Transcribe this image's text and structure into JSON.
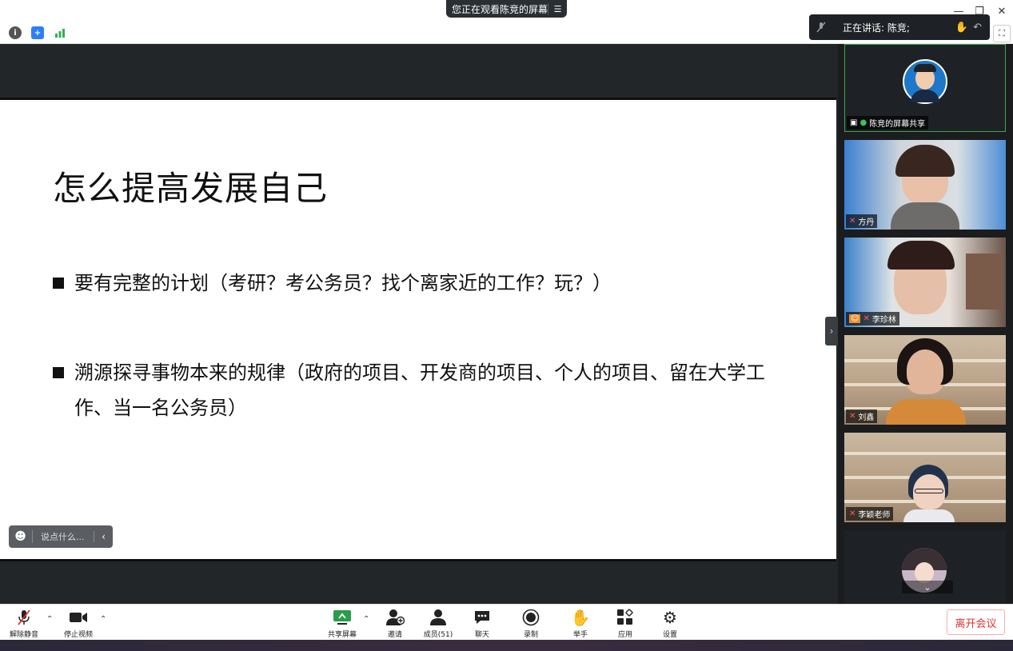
{
  "titlebar": {
    "viewing_text": "您正在观看陈竞的屏幕",
    "menu_icon": "list-icon",
    "minimize": "—",
    "restore": "❐",
    "close": "✕"
  },
  "speaking": {
    "text": "正在讲话: 陈竞;",
    "mic_icon": "mic-muted-icon"
  },
  "slide": {
    "title": "怎么提高发展自己",
    "bullets": [
      "要有完整的计划（考研？考公务员？找个离家近的工作？玩？）",
      "溯源探寻事物本来的规律（政府的项目、开发商的项目、个人的项目、留在大学工作、当一名公务员）"
    ]
  },
  "chat_input": {
    "placeholder": "说点什么..."
  },
  "participants": [
    {
      "name": "陈竞的屏幕共享",
      "role": "host",
      "mic": "on"
    },
    {
      "name": "方丹",
      "mic": "off"
    },
    {
      "name": "李珍林",
      "mic": "off"
    },
    {
      "name": "刘鑫",
      "mic": "off"
    },
    {
      "name": "李颖老师",
      "mic": "off"
    }
  ],
  "toolbar": {
    "unmute": "解除静音",
    "stop_video": "停止视频",
    "share_screen": "共享屏幕",
    "invite": "邀请",
    "members": "成员(51)",
    "chat": "聊天",
    "record": "录制",
    "raise_hand": "举手",
    "apps": "应用",
    "settings": "设置",
    "leave": "离开会议"
  },
  "colors": {
    "accent_green": "#3fa54a",
    "leave_red": "#dd3333",
    "dark_bg": "#232629"
  }
}
